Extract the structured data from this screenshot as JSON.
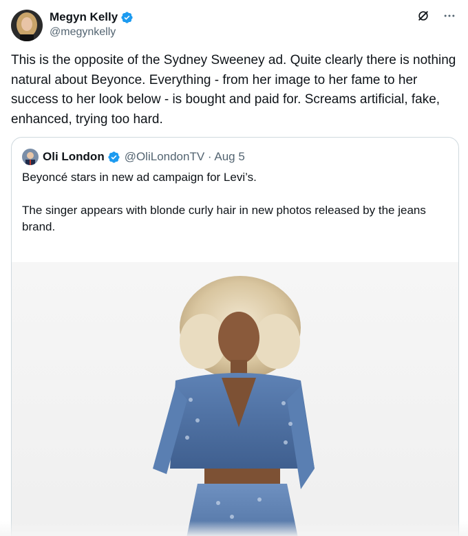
{
  "author": {
    "display_name": "Megyn Kelly",
    "handle": "@megynkelly",
    "verified_icon": "verified-badge-icon",
    "verified_color": "#1d9bf0"
  },
  "tweet": {
    "text": "This is the opposite of the Sydney Sweeney ad. Quite clearly there is nothing natural about Beyonce. Everything - from her image to her fame to her success to her look below - is bought and paid for. Screams artificial, fake, enhanced, trying too hard."
  },
  "actions": {
    "grok_icon": "grok-icon",
    "more_icon": "more-dots-icon"
  },
  "quote": {
    "display_name": "Oli London",
    "handle_date": "@OliLondonTV · Aug 5",
    "text_line1": "Beyoncé stars in new ad campaign for Levi’s.",
    "text_line2": "The singer appears with blonde curly hair in new photos released by the jeans brand.",
    "media_icon": "photo-denim-ad-image"
  },
  "colors": {
    "text_primary": "#0f1419",
    "text_secondary": "#536471",
    "border": "#cfd9de",
    "accent": "#1d9bf0"
  }
}
